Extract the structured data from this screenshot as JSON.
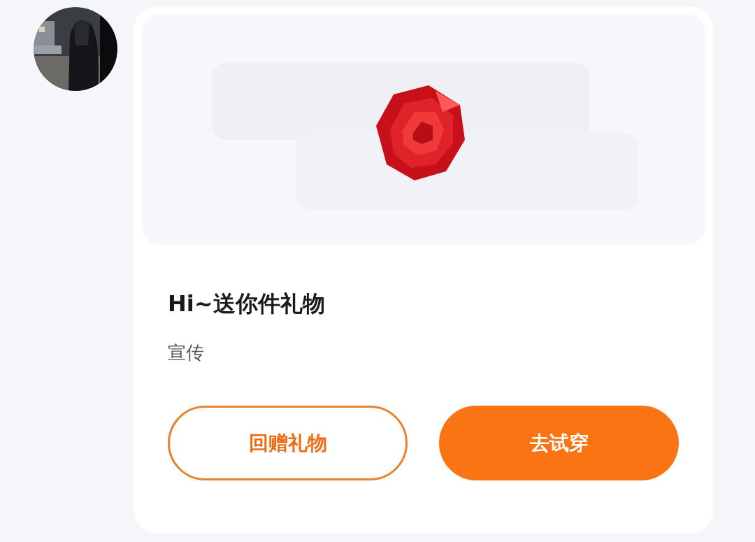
{
  "message": {
    "title": "Hi~送你件礼物",
    "subtitle": "宣传",
    "buttons": [
      {
        "label": "回赠礼物",
        "kind": "outline"
      },
      {
        "label": "去试穿",
        "kind": "filled"
      }
    ]
  }
}
